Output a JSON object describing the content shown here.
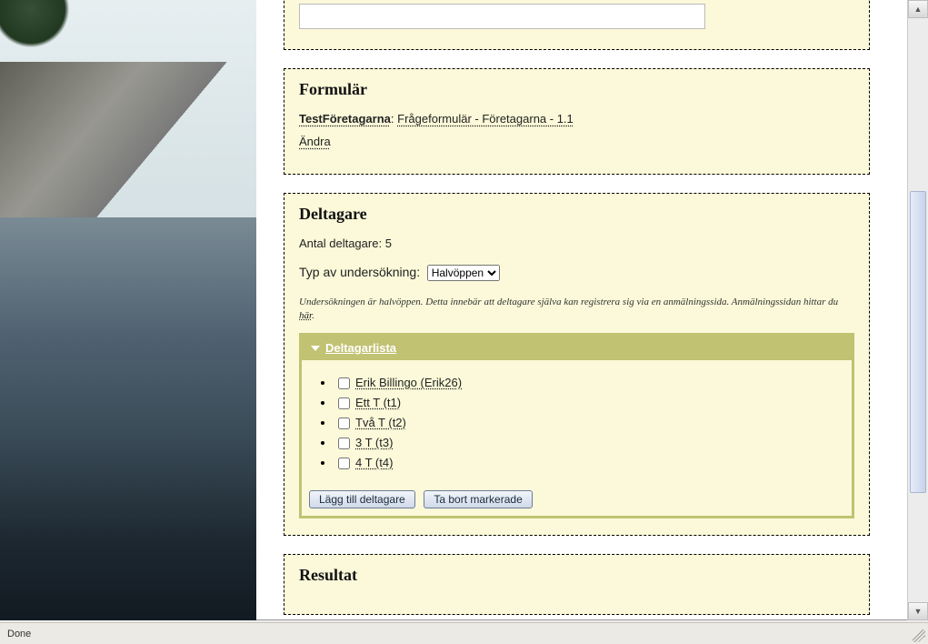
{
  "status_bar": {
    "text": "Done"
  },
  "panels": {
    "formular": {
      "title": "Formulär",
      "owner_label": "TestFöretagarna",
      "separator": ": ",
      "form_label": "Frågeformulär - Företagarna - 1.1",
      "edit_label": "Ändra"
    },
    "deltagare": {
      "title": "Deltagare",
      "count_label_prefix": "Antal deltagare: ",
      "count_value": "5",
      "type_label": "Typ av undersökning:",
      "type_options": [
        "Halvöppen"
      ],
      "type_selected": "Halvöppen",
      "note_text": "Undersökningen är halvöppen. Detta innebär att deltagare själva kan registrera sig via en anmälningssida. Anmälningssidan hittar du ",
      "note_link": "här",
      "note_suffix": ".",
      "list": {
        "header": "Deltagarlista",
        "items": [
          {
            "label": "Erik Billingo (Erik26)"
          },
          {
            "label": "Ett T (t1)"
          },
          {
            "label": "Två T (t2)"
          },
          {
            "label": "3 T (t3)"
          },
          {
            "label": "4 T (t4)"
          }
        ],
        "add_button": "Lägg till deltagare",
        "remove_button": "Ta bort markerade"
      }
    },
    "resultat": {
      "title": "Resultat"
    }
  }
}
